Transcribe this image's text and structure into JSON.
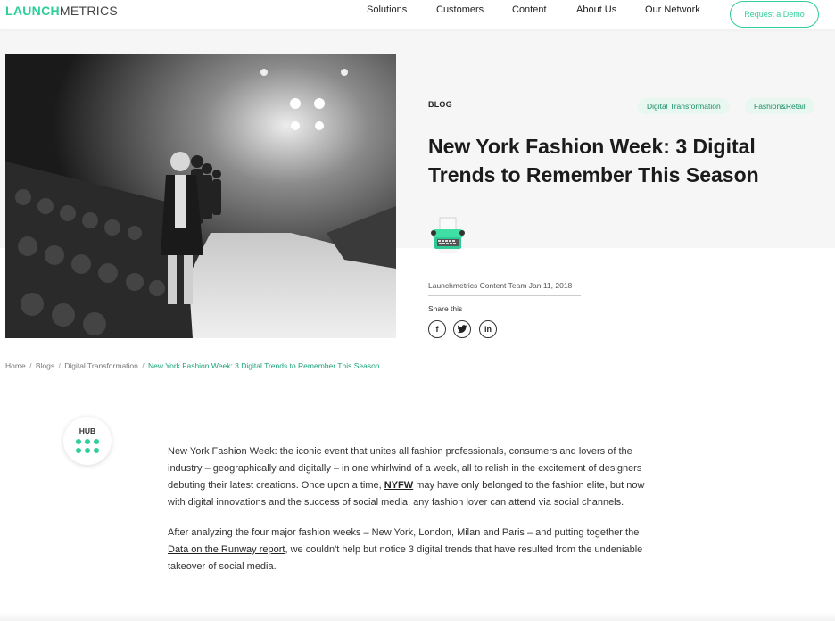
{
  "header": {
    "logo_part1": "LAUNCH",
    "logo_part2": "METRICS",
    "nav": [
      "Solutions",
      "Customers",
      "Content",
      "About Us",
      "Our Network"
    ],
    "cta_label": "Request a Demo"
  },
  "hero": {
    "category": "BLOG",
    "tags": [
      "Digital Transformation",
      "Fashion&Retail"
    ],
    "title": "New York Fashion Week: 3 Digital Trends to Remember This Season",
    "author_date": "Launchmetrics Content Team Jan 11, 2018",
    "share_label": "Share this",
    "share_icons": [
      "facebook-icon",
      "twitter-icon",
      "linkedin-icon"
    ]
  },
  "breadcrumb": {
    "items": [
      "Home",
      "Blogs",
      "Digital Transformation"
    ],
    "separator": "/",
    "current": "New York Fashion Week: 3 Digital Trends to Remember This Season"
  },
  "hub": {
    "label": "HUB"
  },
  "article": {
    "p1_before": "New York Fashion Week: the iconic event that unites all fashion professionals, consumers and lovers of the industry – geographically and digitally – in one whirlwind of a week, all to relish in the excitement of designers debuting their latest creations. Once upon a time, ",
    "p1_link": "NYFW",
    "p1_after": " may have only belonged to the fashion elite, but now with digital innovations and the success of social media, any fashion lover can attend via social channels.",
    "p2_before": "After analyzing the four major fashion weeks – New York, London, Milan and Paris – and putting together the ",
    "p2_link": "Data on the Runway report",
    "p2_after": ", we couldn't help but notice 3 digital trends that have resulted from the undeniable takeover of social media."
  },
  "colors": {
    "accent": "#2fcf9a",
    "tag_bg": "#e8f7f0",
    "hero_band": "#f6f6f6"
  }
}
